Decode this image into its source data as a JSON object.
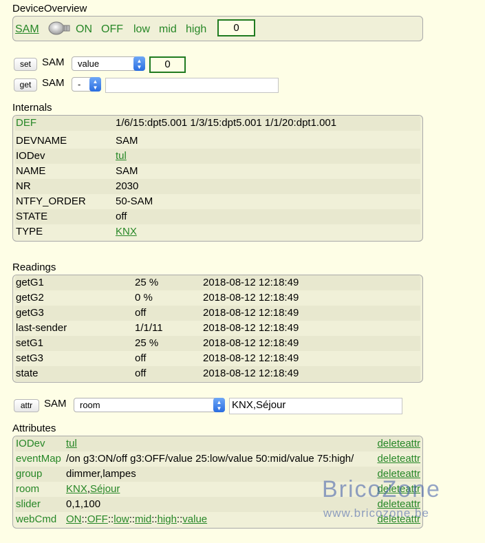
{
  "overview": {
    "title": "DeviceOverview",
    "device": "SAM",
    "commands": [
      "ON",
      "OFF",
      "low",
      "mid",
      "high"
    ],
    "value": "0",
    "icon": "lightbulb-icon"
  },
  "set_row": {
    "button": "set",
    "device": "SAM",
    "select": "value",
    "value": "0"
  },
  "get_row": {
    "button": "get",
    "device": "SAM",
    "select": "-",
    "value": ""
  },
  "internals": {
    "title": "Internals",
    "rows": [
      {
        "name": "DEF",
        "value": "1/6/15:dpt5.001 1/3/15:dpt5.001 1/1/20:dpt1.001"
      },
      {
        "name": "DEVNAME",
        "value": "SAM"
      },
      {
        "name": "IODev",
        "value": "tul"
      },
      {
        "name": "NAME",
        "value": "SAM"
      },
      {
        "name": "NR",
        "value": "2030"
      },
      {
        "name": "NTFY_ORDER",
        "value": "50-SAM"
      },
      {
        "name": "STATE",
        "value": "off"
      },
      {
        "name": "TYPE",
        "value": "KNX"
      }
    ]
  },
  "readings": {
    "title": "Readings",
    "rows": [
      {
        "name": "getG1",
        "value": "25 %",
        "time": "2018-08-12 12:18:49"
      },
      {
        "name": "getG2",
        "value": "0 %",
        "time": "2018-08-12 12:18:49"
      },
      {
        "name": "getG3",
        "value": "off",
        "time": "2018-08-12 12:18:49"
      },
      {
        "name": "last-sender",
        "value": "1/1/11",
        "time": "2018-08-12 12:18:49"
      },
      {
        "name": "setG1",
        "value": "25 %",
        "time": "2018-08-12 12:18:49"
      },
      {
        "name": "setG3",
        "value": "off",
        "time": "2018-08-12 12:18:49"
      },
      {
        "name": "state",
        "value": "off",
        "time": "2018-08-12 12:18:49"
      }
    ]
  },
  "attr_row": {
    "button": "attr",
    "device": "SAM",
    "select": "room",
    "value": "KNX,Séjour"
  },
  "attributes": {
    "title": "Attributes",
    "delete_label": "deleteattr",
    "rows": [
      {
        "name": "IODev",
        "parts": [
          "tul"
        ]
      },
      {
        "name": "eventMap",
        "parts": [
          "/on g3:ON/off g3:OFF/value 25:low/value 50:mid/value 75:high/"
        ]
      },
      {
        "name": "group",
        "parts": [
          "dimmer,lampes"
        ]
      },
      {
        "name": "room",
        "parts": [
          "KNX",
          ",",
          "Séjour"
        ]
      },
      {
        "name": "slider",
        "parts": [
          "0,1,100"
        ]
      },
      {
        "name": "webCmd",
        "parts": [
          "ON",
          "::",
          "OFF",
          "::",
          "low",
          "::",
          "mid",
          "::",
          "high",
          "::",
          "value"
        ]
      }
    ]
  },
  "watermark": {
    "brand": "BricoZone",
    "url": "www.bricozone.be"
  },
  "colors": {
    "background": "#fefee6",
    "panel": "#f0f0d8",
    "link": "#278727",
    "value_box_border": "#1f7a1f"
  }
}
